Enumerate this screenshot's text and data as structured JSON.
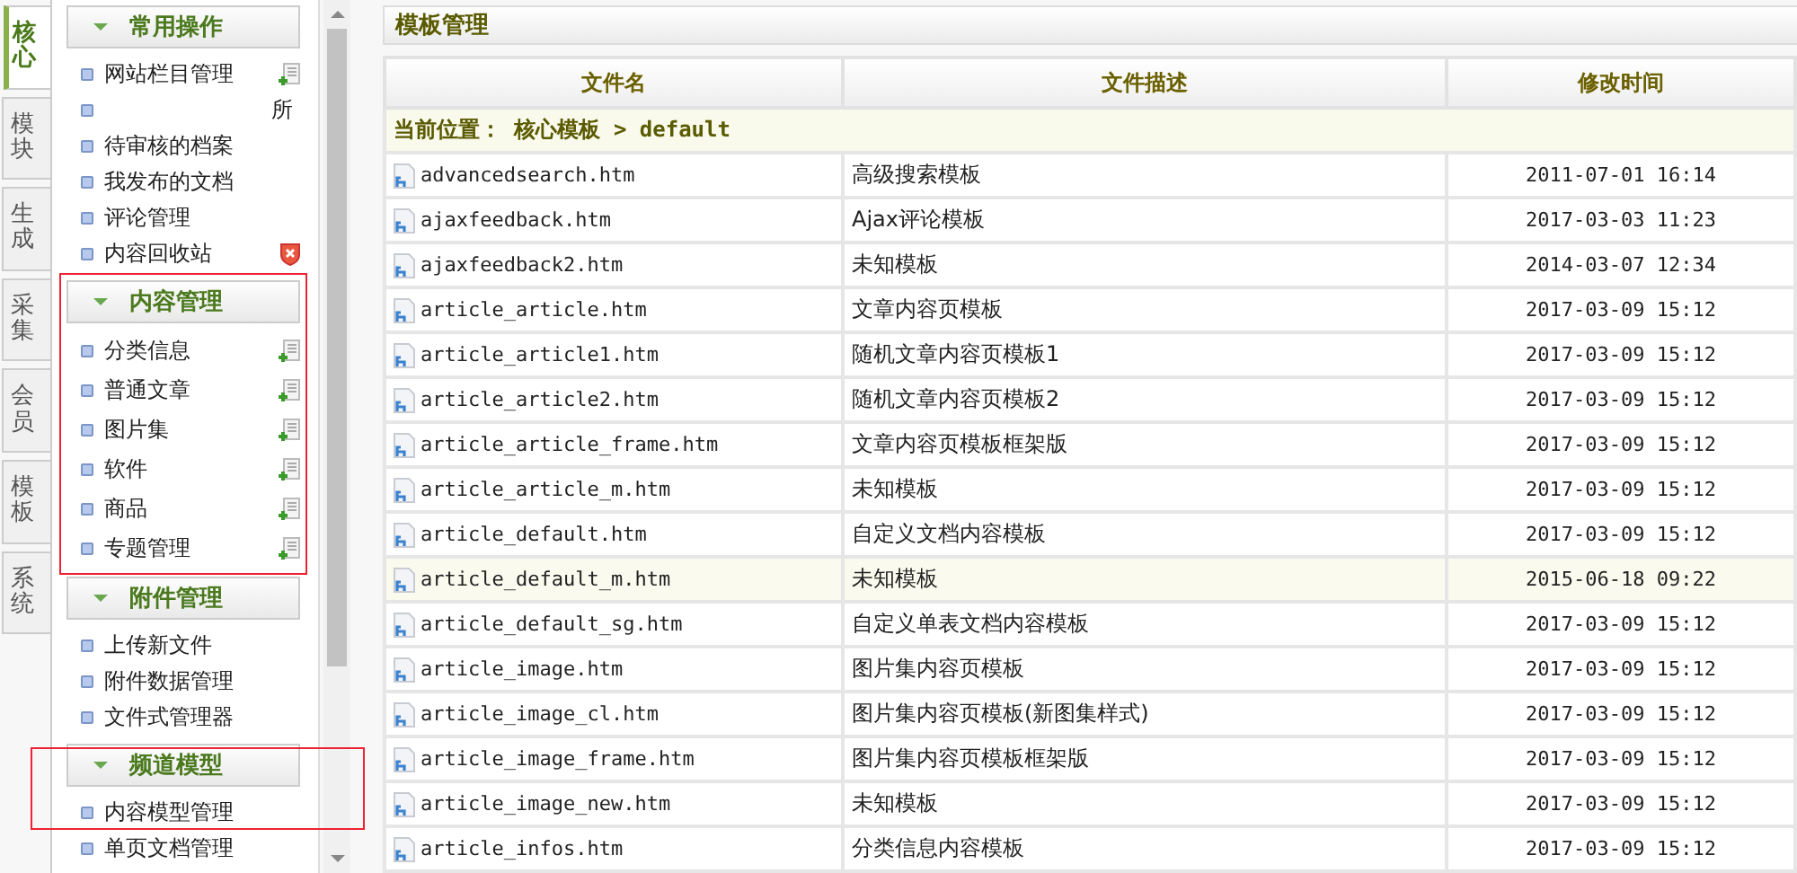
{
  "side_tabs": [
    {
      "label": "核心",
      "selected": true
    },
    {
      "label": "模块",
      "selected": false
    },
    {
      "label": "生成",
      "selected": false
    },
    {
      "label": "采集",
      "selected": false
    },
    {
      "label": "会员",
      "selected": false
    },
    {
      "label": "模板",
      "selected": false
    },
    {
      "label": "系统",
      "selected": false
    }
  ],
  "menu": [
    {
      "title": "常用操作",
      "annotated": false,
      "items": [
        {
          "label": "网站栏目管理",
          "kind": "add"
        },
        {
          "label": "所",
          "kind": "offset"
        },
        {
          "label": "待审核的档案",
          "kind": "plain"
        },
        {
          "label": "我发布的文档",
          "kind": "plain"
        },
        {
          "label": "评论管理",
          "kind": "plain"
        },
        {
          "label": "内容回收站",
          "kind": "trash"
        }
      ]
    },
    {
      "title": "内容管理",
      "annotated": true,
      "items": [
        {
          "label": "分类信息",
          "kind": "add"
        },
        {
          "label": "普通文章",
          "kind": "add"
        },
        {
          "label": "图片集",
          "kind": "add"
        },
        {
          "label": "软件",
          "kind": "add"
        },
        {
          "label": "商品",
          "kind": "add"
        },
        {
          "label": "专题管理",
          "kind": "add"
        }
      ]
    },
    {
      "title": "附件管理",
      "annotated": false,
      "items": [
        {
          "label": "上传新文件",
          "kind": "plain"
        },
        {
          "label": "附件数据管理",
          "kind": "plain"
        },
        {
          "label": "文件式管理器",
          "kind": "plain"
        }
      ]
    },
    {
      "title": "频道模型",
      "annotated": true,
      "items": [
        {
          "label": "内容模型管理",
          "kind": "plain"
        },
        {
          "label": "单页文档管理",
          "kind": "plain"
        }
      ]
    }
  ],
  "main": {
    "title": "模板管理",
    "table": {
      "columns": [
        "文件名",
        "文件描述",
        "修改时间"
      ],
      "breadcrumb": {
        "label": "当前位置：",
        "path": "核心模板 > default"
      },
      "rows": [
        {
          "file": "advancedsearch.htm",
          "description": "高级搜索模板",
          "modified": "2011-07-01 16:14",
          "highlighted": false
        },
        {
          "file": "ajaxfeedback.htm",
          "description": "Ajax评论模板",
          "modified": "2017-03-03 11:23",
          "highlighted": false
        },
        {
          "file": "ajaxfeedback2.htm",
          "description": "未知模板",
          "modified": "2014-03-07 12:34",
          "highlighted": false
        },
        {
          "file": "article_article.htm",
          "description": "文章内容页模板",
          "modified": "2017-03-09 15:12",
          "highlighted": false
        },
        {
          "file": "article_article1.htm",
          "description": "随机文章内容页模板1",
          "modified": "2017-03-09 15:12",
          "highlighted": false
        },
        {
          "file": "article_article2.htm",
          "description": "随机文章内容页模板2",
          "modified": "2017-03-09 15:12",
          "highlighted": false
        },
        {
          "file": "article_article_frame.htm",
          "description": "文章内容页模板框架版",
          "modified": "2017-03-09 15:12",
          "highlighted": false
        },
        {
          "file": "article_article_m.htm",
          "description": "未知模板",
          "modified": "2017-03-09 15:12",
          "highlighted": false
        },
        {
          "file": "article_default.htm",
          "description": "自定义文档内容模板",
          "modified": "2017-03-09 15:12",
          "highlighted": false
        },
        {
          "file": "article_default_m.htm",
          "description": "未知模板",
          "modified": "2015-06-18 09:22",
          "highlighted": true
        },
        {
          "file": "article_default_sg.htm",
          "description": "自定义单表文档内容模板",
          "modified": "2017-03-09 15:12",
          "highlighted": false
        },
        {
          "file": "article_image.htm",
          "description": "图片集内容页模板",
          "modified": "2017-03-09 15:12",
          "highlighted": false
        },
        {
          "file": "article_image_cl.htm",
          "description": "图片集内容页模板(新图集样式)",
          "modified": "2017-03-09 15:12",
          "highlighted": false
        },
        {
          "file": "article_image_frame.htm",
          "description": "图片集内容页模板框架版",
          "modified": "2017-03-09 15:12",
          "highlighted": false
        },
        {
          "file": "article_image_new.htm",
          "description": "未知模板",
          "modified": "2017-03-09 15:12",
          "highlighted": false
        },
        {
          "file": "article_infos.htm",
          "description": "分类信息内容模板",
          "modified": "2017-03-09 15:12",
          "highlighted": false
        }
      ]
    }
  }
}
